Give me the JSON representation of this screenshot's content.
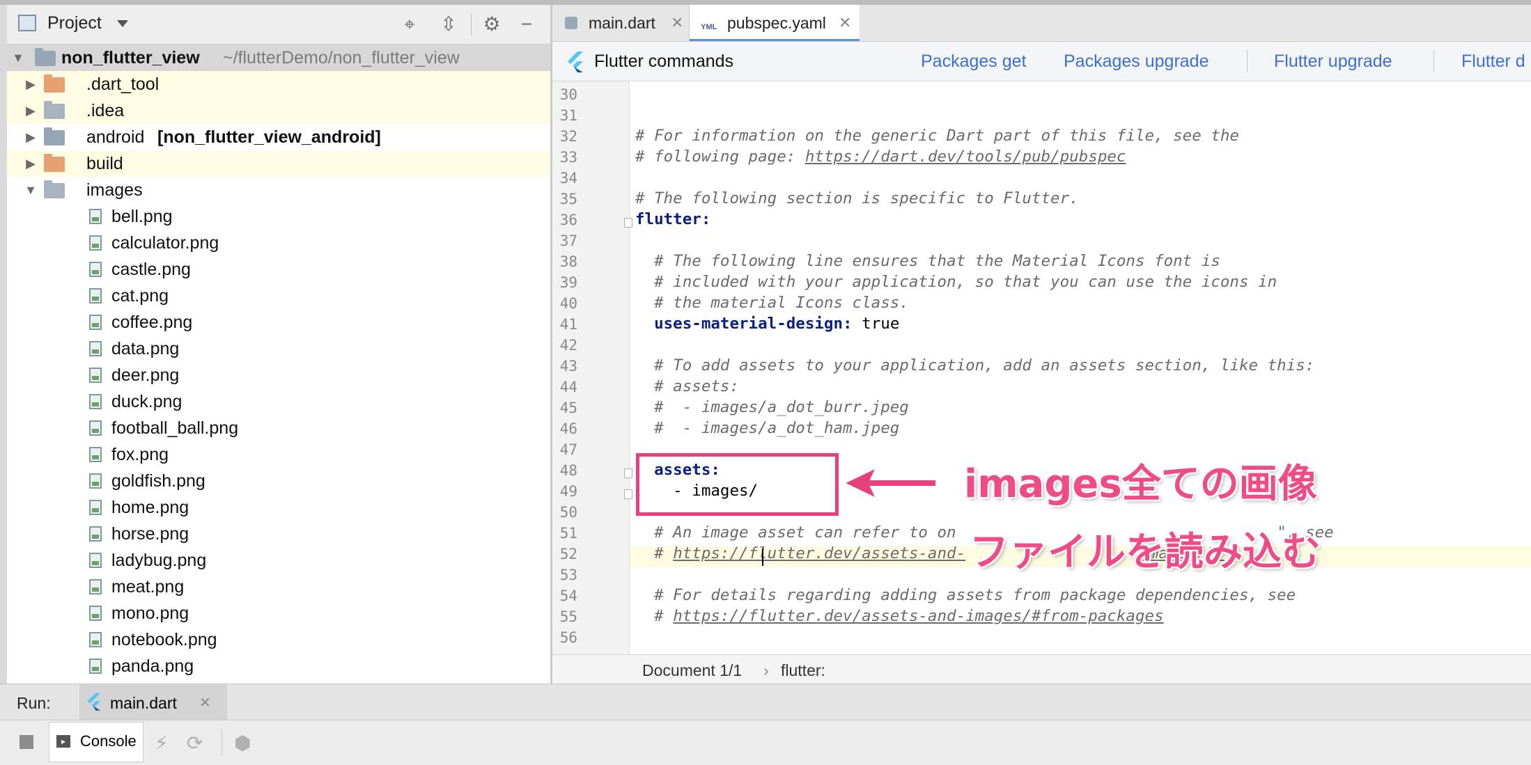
{
  "project_panel": {
    "title": "Project",
    "root": {
      "name": "non_flutter_view",
      "path": "~/flutterDemo/non_flutter_view"
    },
    "items": [
      {
        "label": ".dart_tool",
        "type": "folder"
      },
      {
        "label": ".idea",
        "type": "folder"
      },
      {
        "label": "android",
        "module": "[non_flutter_view_android]",
        "type": "folder"
      },
      {
        "label": "build",
        "type": "folder"
      },
      {
        "label": "images",
        "type": "folder"
      }
    ],
    "files": [
      "bell.png",
      "calculator.png",
      "castle.png",
      "cat.png",
      "coffee.png",
      "data.png",
      "deer.png",
      "duck.png",
      "football_ball.png",
      "fox.png",
      "goldfish.png",
      "home.png",
      "horse.png",
      "ladybug.png",
      "meat.png",
      "mono.png",
      "notebook.png",
      "panda.png"
    ]
  },
  "editor": {
    "tabs": [
      {
        "label": "main.dart"
      },
      {
        "label": "pubspec.yaml",
        "badge": "YML"
      }
    ],
    "commands": {
      "title": "Flutter commands",
      "links": [
        "Packages get",
        "Packages upgrade",
        "Flutter upgrade",
        "Flutter d"
      ]
    },
    "lines": [
      {
        "n": "30",
        "t": ""
      },
      {
        "n": "31",
        "t": ""
      },
      {
        "n": "32",
        "t": "# For information on the generic Dart part of this file, see the"
      },
      {
        "n": "33",
        "t": "# following page: ",
        "u": "https://dart.dev/tools/pub/pubspec"
      },
      {
        "n": "34",
        "t": ""
      },
      {
        "n": "35",
        "t": "# The following section is specific to Flutter."
      },
      {
        "n": "36",
        "k": "flutter:"
      },
      {
        "n": "37",
        "t": ""
      },
      {
        "n": "38",
        "t": "  # The following line ensures that the Material Icons font is"
      },
      {
        "n": "39",
        "t": "  # included with your application, so that you can use the icons in"
      },
      {
        "n": "40",
        "t": "  # the material Icons class."
      },
      {
        "n": "41",
        "k": "  uses-material-design:",
        "v": " true"
      },
      {
        "n": "42",
        "t": ""
      },
      {
        "n": "43",
        "t": "  # To add assets to your application, add an assets section, like this:"
      },
      {
        "n": "44",
        "t": "  # assets:"
      },
      {
        "n": "45",
        "t": "  #  - images/a_dot_burr.jpeg"
      },
      {
        "n": "46",
        "t": "  #  - images/a_dot_ham.jpeg"
      },
      {
        "n": "47",
        "t": ""
      },
      {
        "n": "48",
        "k": "  assets:"
      },
      {
        "n": "49",
        "v": "    - images/"
      },
      {
        "n": "50",
        "t": ""
      },
      {
        "n": "51",
        "t": "  # An image asset can refer to on",
        "t2": "\", see"
      },
      {
        "n": "52",
        "t": "  # ",
        "u": "https://flutter.dev/assets-and-",
        "u2": "images/#r"
      },
      {
        "n": "53",
        "t": ""
      },
      {
        "n": "54",
        "t": "  # For details regarding adding assets from package dependencies, see"
      },
      {
        "n": "55",
        "t": "  # ",
        "u": "https://flutter.dev/assets-and-images/#from-packages"
      },
      {
        "n": "56",
        "t": ""
      }
    ],
    "breadcrumb": [
      "Document 1/1",
      "flutter:"
    ]
  },
  "annotation": {
    "line1": "images全ての画像",
    "line2": "ファイルを読み込む",
    "color": "#f04b86"
  },
  "run_panel": {
    "label": "Run:",
    "tab": "main.dart",
    "console": "Console"
  }
}
